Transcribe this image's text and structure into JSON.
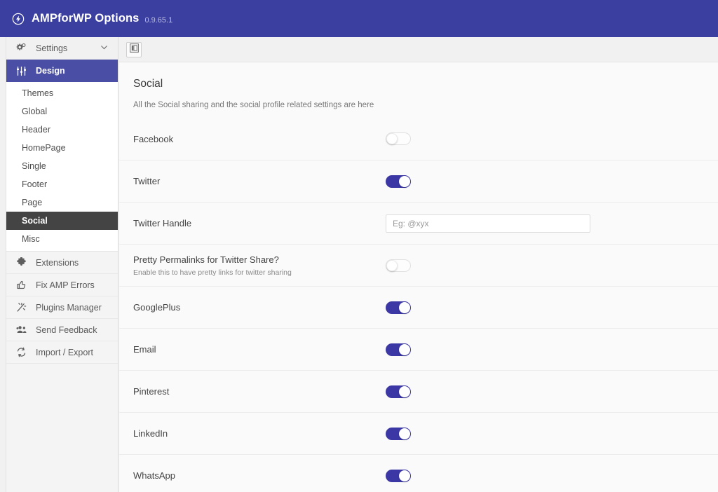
{
  "header": {
    "logo_icon": "amp-bolt-circle-icon",
    "title": "AMPforWP Options",
    "version": "0.9.65.1"
  },
  "sidebar": {
    "settings": {
      "label": "Settings",
      "icon": "cogs-icon",
      "chevron": "chevron-down-icon"
    },
    "design": {
      "label": "Design",
      "icon": "sliders-icon"
    },
    "sub_items": [
      {
        "label": "Themes"
      },
      {
        "label": "Global"
      },
      {
        "label": "Header"
      },
      {
        "label": "HomePage"
      },
      {
        "label": "Single"
      },
      {
        "label": "Footer"
      },
      {
        "label": "Page"
      },
      {
        "label": "Social"
      },
      {
        "label": "Misc"
      }
    ],
    "items": [
      {
        "label": "Extensions",
        "icon": "puzzle-piece-icon"
      },
      {
        "label": "Fix AMP Errors",
        "icon": "thumbs-up-icon"
      },
      {
        "label": "Plugins Manager",
        "icon": "magic-wand-icon"
      },
      {
        "label": "Send Feedback",
        "icon": "users-icon"
      },
      {
        "label": "Import / Export",
        "icon": "refresh-icon"
      }
    ]
  },
  "toolbar": {
    "layout_toggle_icon": "sidebar-layout-icon"
  },
  "main": {
    "title": "Social",
    "description": "All the Social sharing and the social profile related settings are here",
    "rows": [
      {
        "label": "Facebook",
        "sub": "",
        "control": "toggle",
        "state": "off"
      },
      {
        "label": "Twitter",
        "sub": "",
        "control": "toggle",
        "state": "on"
      },
      {
        "label": "Twitter Handle",
        "sub": "",
        "control": "text",
        "value": "",
        "placeholder": "Eg: @xyx"
      },
      {
        "label": "Pretty Permalinks for Twitter Share?",
        "sub": "Enable this to have pretty links for twitter sharing",
        "control": "toggle",
        "state": "off"
      },
      {
        "label": "GooglePlus",
        "sub": "",
        "control": "toggle",
        "state": "on"
      },
      {
        "label": "Email",
        "sub": "",
        "control": "toggle",
        "state": "on"
      },
      {
        "label": "Pinterest",
        "sub": "",
        "control": "toggle",
        "state": "on"
      },
      {
        "label": "LinkedIn",
        "sub": "",
        "control": "toggle",
        "state": "on"
      },
      {
        "label": "WhatsApp",
        "sub": "",
        "control": "toggle",
        "state": "on"
      }
    ]
  },
  "colors": {
    "brand_blue": "#3b40a0",
    "active_nav_blue": "#4a4fa5",
    "active_sub_dark": "#444444",
    "toggle_on": "#3b37a5"
  }
}
